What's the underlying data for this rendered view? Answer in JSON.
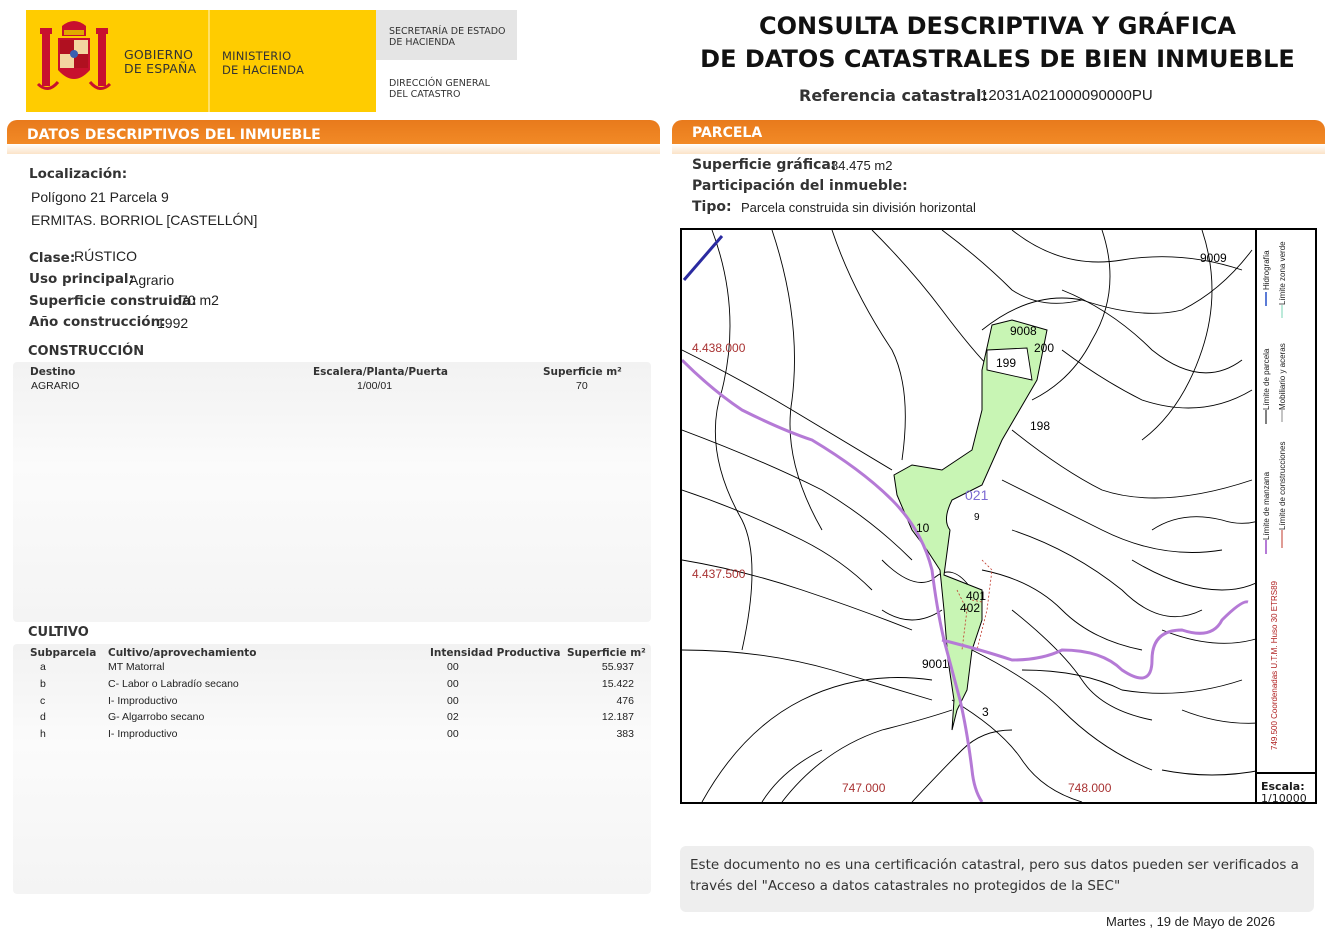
{
  "header": {
    "gov_line1": "GOBIERNO",
    "gov_line2": "DE ESPAÑA",
    "ministry_line1": "MINISTERIO",
    "ministry_line2": "DE HACIENDA",
    "secretaria_line1": "SECRETARÍA DE ESTADO",
    "secretaria_line2": "DE HACIENDA",
    "direccion_line1": "DIRECCIÓN GENERAL",
    "direccion_line2": "DEL CATASTRO",
    "title_line1": "CONSULTA DESCRIPTIVA Y GRÁFICA",
    "title_line2": "DE DATOS CATASTRALES DE BIEN INMUEBLE",
    "ref_label": "Referencia catastral:",
    "ref_value": "12031A021000090000PU",
    "brand_color": "#ffcc00",
    "accent_color": "#f08a24",
    "crest_icon": "coat-of-arms-icon"
  },
  "descriptive": {
    "section_title": "DATOS DESCRIPTIVOS DEL INMUEBLE",
    "localizacion_label": "Localización:",
    "localizacion_line1": "Polígono 21 Parcela 9",
    "localizacion_line2": "ERMITAS. BORRIOL [CASTELLÓN]",
    "clase_label": "Clase:",
    "clase_value": "RÚSTICO",
    "uso_label": "Uso principal:",
    "uso_value": "Agrario",
    "superficie_label": "Superficie construida:",
    "superficie_value": "70 m2",
    "anio_label": "Año construcción:",
    "anio_value": "1992"
  },
  "construccion": {
    "title": "CONSTRUCCIÓN",
    "headers": [
      "Destino",
      "Escalera/Planta/Puerta",
      "Superficie m²"
    ],
    "rows": [
      [
        "AGRARIO",
        "1/00/01",
        "70"
      ]
    ]
  },
  "cultivo": {
    "title": "CULTIVO",
    "headers": [
      "Subparcela",
      "Cultivo/aprovechamiento",
      "Intensidad Productiva",
      "Superficie m²"
    ],
    "rows": [
      [
        "a",
        "MT Matorral",
        "00",
        "55.937"
      ],
      [
        "b",
        "C- Labor o Labradío secano",
        "00",
        "15.422"
      ],
      [
        "c",
        "I- Improductivo",
        "00",
        "476"
      ],
      [
        "d",
        "G- Algarrobo secano",
        "02",
        "12.187"
      ],
      [
        "h",
        "I- Improductivo",
        "00",
        "383"
      ]
    ]
  },
  "parcela": {
    "section_title": "PARCELA",
    "superficie_label": "Superficie gráfica:",
    "superficie_value": "84.475 m2",
    "participacion_label": "Participación del inmueble:",
    "tipo_label": "Tipo:",
    "tipo_value": "Parcela construida sin división horizontal"
  },
  "map": {
    "labels": {
      "y1": "4.438.000",
      "y2": "4.437.500",
      "x1": "747.000",
      "x2": "748.000",
      "p9009": "9009",
      "p9008": "9008",
      "p200": "200",
      "p199": "199",
      "p198": "198",
      "p021": "021",
      "p9": "9",
      "p10": "10",
      "p401": "401",
      "p402": "402",
      "p9001": "9001",
      "p3": "3"
    },
    "legend": {
      "item1": "Límite de manzana",
      "item2": "Límite de parcela",
      "item3": "Hidrografía",
      "item4": "Límite de construcciones",
      "item5": "Mobiliario y aceras",
      "item6": "Límite zona verde",
      "coords": "749.500 Coordenadas U.T.M. Huso 30 ETRS89"
    },
    "escala_label": "Escala:",
    "escala_value": "1/10000",
    "parcel_color": "#c8f5b4",
    "manzana_color": "#b57ad6"
  },
  "footer": {
    "note": "Este documento no es una certificación catastral, pero sus datos pueden ser verificados a través del \"Acceso a datos catastrales no protegidos de la SEC\"",
    "date": "Martes , 19 de Mayo de 2026"
  }
}
